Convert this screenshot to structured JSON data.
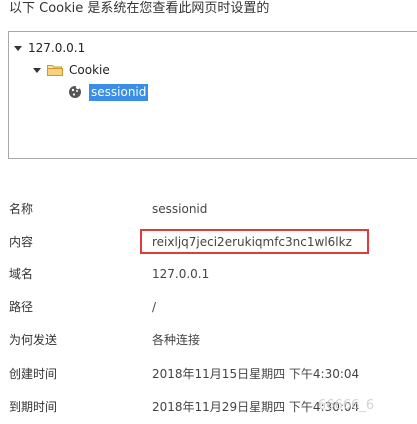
{
  "header": {
    "text": "以下 Cookie 是系统在您查看此网页时设置的"
  },
  "tree": {
    "root_label": "127.0.0.1",
    "folder_label": "Cookie",
    "selected_label": "sessionid"
  },
  "details": [
    {
      "label": "名称",
      "value": "sessionid"
    },
    {
      "label": "内容",
      "value": "reixljq7jeci2erukiqmfc3nc1wl6lkz"
    },
    {
      "label": "域名",
      "value": "127.0.0.1"
    },
    {
      "label": "路径",
      "value": "/"
    },
    {
      "label": "为何发送",
      "value": "各种连接"
    },
    {
      "label": "创建时间",
      "value": "2018年11月15日星期四 下午4:30:04"
    },
    {
      "label": "到期时间",
      "value": "2018年11月29日星期四 下午4:30:04"
    }
  ],
  "colors": {
    "selection": "#3a8ee6",
    "highlight_border": "#e03b3b",
    "folder": "#f2c75c"
  },
  "watermark": "66666_6"
}
